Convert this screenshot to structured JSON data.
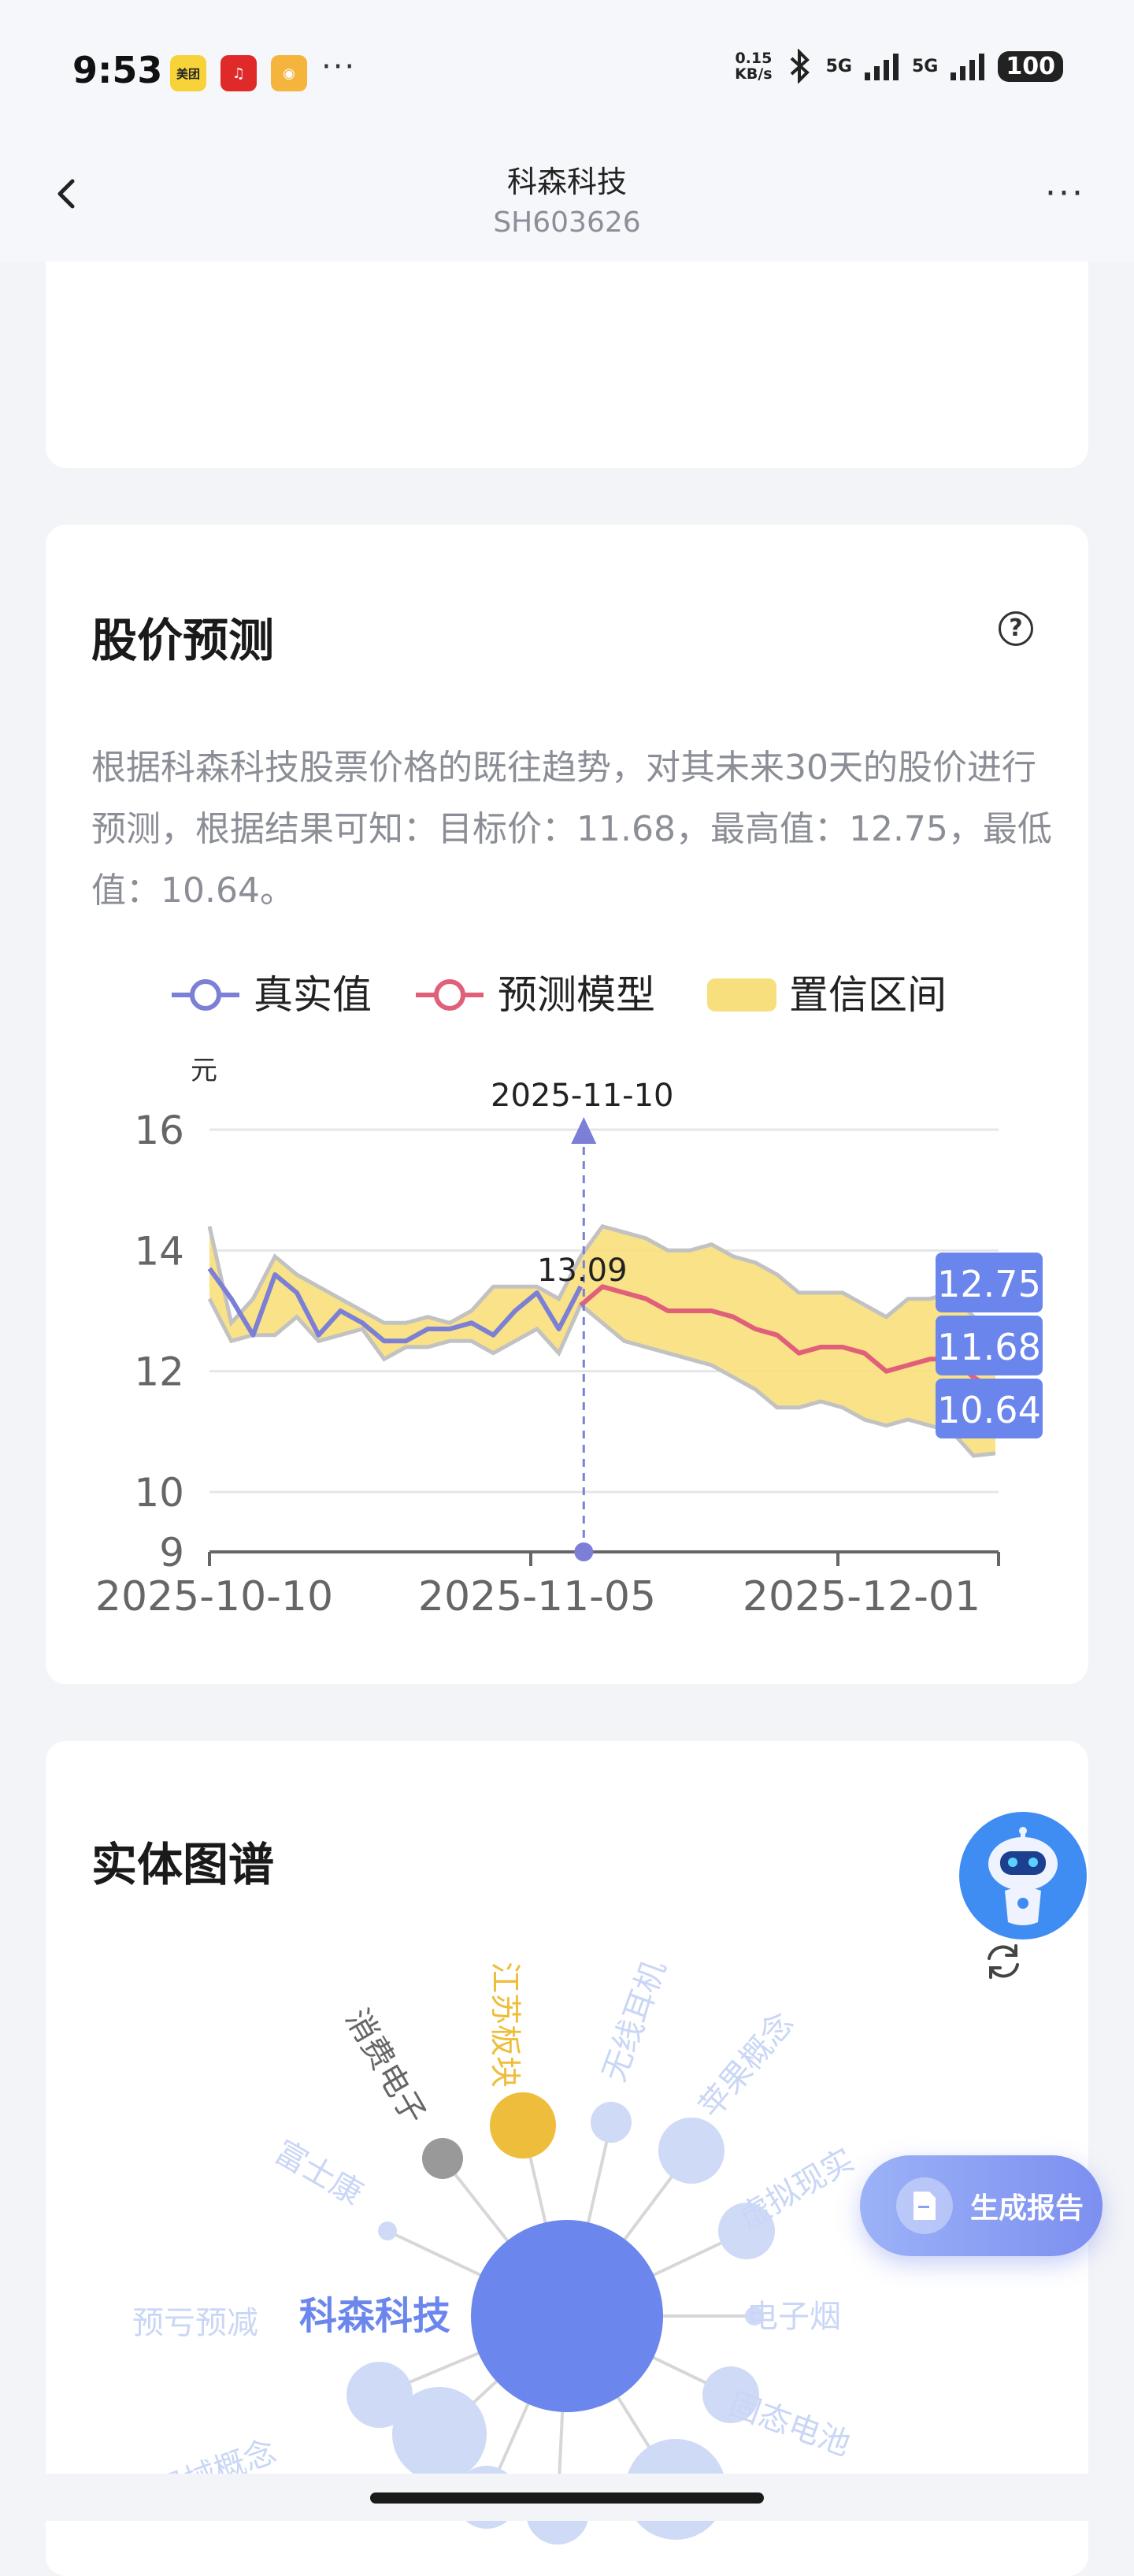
{
  "status_bar": {
    "time": "9:53",
    "apps": [
      {
        "name": "meituan-icon",
        "label": "美团",
        "color": "#f7d339"
      },
      {
        "name": "netease-music-icon",
        "label": "♫",
        "color": "#e02a2a"
      },
      {
        "name": "weibo-icon",
        "label": "◉",
        "color": "#f5b53d"
      }
    ],
    "more": "···",
    "net_speed_value": "0.15",
    "net_speed_unit": "KB/s",
    "sim1": "5G",
    "sim2": "5G",
    "battery": "100"
  },
  "nav": {
    "title": "科森科技",
    "code": "SH603626",
    "more": "···"
  },
  "prediction": {
    "title": "股价预测",
    "help": "?",
    "description": "根据科森科技股票价格的既往趋势，对其未来30天的股价进行预测，根据结果可知：目标价：11.68，最高值：12.75，最低值：10.64。"
  },
  "chart_data": {
    "type": "line",
    "legend": [
      "真实值",
      "预测模型",
      "置信区间"
    ],
    "ylabel": "元",
    "ylim": [
      9,
      16
    ],
    "yticks": [
      9,
      10,
      12,
      14,
      16
    ],
    "xticks": [
      "2025-10-10",
      "2025-11-05",
      "2025-12-01"
    ],
    "marker_date": "2025-11-10",
    "marker_value": "13.09",
    "end_labels": [
      "12.75",
      "11.68",
      "10.64"
    ],
    "x_index_range": [
      0,
      36
    ],
    "real": {
      "name": "真实值",
      "x": [
        0,
        1,
        2,
        3,
        4,
        5,
        6,
        7,
        8,
        9,
        10,
        11,
        12,
        13,
        14,
        15,
        16,
        17
      ],
      "values": [
        13.7,
        13.2,
        12.6,
        13.6,
        13.3,
        12.6,
        13.0,
        12.8,
        12.5,
        12.5,
        12.7,
        12.7,
        12.8,
        12.6,
        13.0,
        13.3,
        12.7,
        13.4
      ]
    },
    "predicted": {
      "name": "预测模型",
      "x": [
        17,
        18,
        19,
        20,
        21,
        22,
        23,
        24,
        25,
        26,
        27,
        28,
        29,
        30,
        31,
        32,
        33,
        34,
        35,
        36
      ],
      "values": [
        13.09,
        13.4,
        13.3,
        13.2,
        13.0,
        13.0,
        13.0,
        12.9,
        12.7,
        12.6,
        12.3,
        12.4,
        12.4,
        12.3,
        12.0,
        12.1,
        12.2,
        12.2,
        11.9,
        11.68
      ]
    },
    "band_upper": {
      "x": [
        0,
        1,
        2,
        3,
        4,
        5,
        6,
        7,
        8,
        9,
        10,
        11,
        12,
        13,
        14,
        15,
        16,
        17,
        18,
        19,
        20,
        21,
        22,
        23,
        24,
        25,
        26,
        27,
        28,
        29,
        30,
        31,
        32,
        33,
        34,
        35,
        36
      ],
      "values": [
        14.4,
        12.8,
        13.2,
        13.9,
        13.6,
        13.4,
        13.2,
        13.0,
        12.8,
        12.8,
        12.9,
        12.8,
        13.0,
        13.4,
        13.4,
        13.4,
        13.2,
        13.9,
        14.4,
        14.3,
        14.2,
        14.0,
        14.0,
        14.1,
        13.9,
        13.8,
        13.6,
        13.3,
        13.3,
        13.3,
        13.1,
        12.9,
        13.2,
        13.2,
        13.3,
        12.9,
        12.75
      ]
    },
    "band_lower": {
      "x": [
        0,
        1,
        2,
        3,
        4,
        5,
        6,
        7,
        8,
        9,
        10,
        11,
        12,
        13,
        14,
        15,
        16,
        17,
        18,
        19,
        20,
        21,
        22,
        23,
        24,
        25,
        26,
        27,
        28,
        29,
        30,
        31,
        32,
        33,
        34,
        35,
        36
      ],
      "values": [
        13.2,
        12.5,
        12.6,
        12.6,
        12.9,
        12.5,
        12.6,
        12.7,
        12.2,
        12.4,
        12.4,
        12.5,
        12.5,
        12.3,
        12.5,
        12.7,
        12.3,
        13.1,
        12.8,
        12.5,
        12.4,
        12.3,
        12.2,
        12.1,
        11.9,
        11.7,
        11.4,
        11.4,
        11.5,
        11.4,
        11.2,
        11.1,
        11.2,
        11.1,
        11.0,
        10.6,
        10.64
      ]
    },
    "colors": {
      "real": "#7b7fd6",
      "predicted": "#e0607a",
      "band": "#f8df7d",
      "band_edge": "#c2c2c2",
      "end_label_bg": "#6a86ec",
      "marker": "#7b7fd6"
    }
  },
  "entity": {
    "title": "实体图谱",
    "center": "科森科技",
    "nodes": [
      {
        "label": "江苏板块",
        "color": "#eebd3b"
      },
      {
        "label": "消费电子",
        "color": "#999999"
      },
      {
        "label": "无线耳机",
        "color": "#cfdaf7"
      },
      {
        "label": "苹果概念",
        "color": "#cfdaf7"
      },
      {
        "label": "富士康",
        "color": "#cfdaf7"
      },
      {
        "label": "虚拟现实",
        "color": "#cfdaf7"
      },
      {
        "label": "预亏预减",
        "color": "#cfdaf7"
      },
      {
        "label": "电子烟",
        "color": "#cfdaf7"
      },
      {
        "label": "器械概念",
        "color": "#cfdaf7"
      },
      {
        "label": "固态电池",
        "color": "#cfdaf7"
      }
    ],
    "report_button": "生成报告"
  }
}
